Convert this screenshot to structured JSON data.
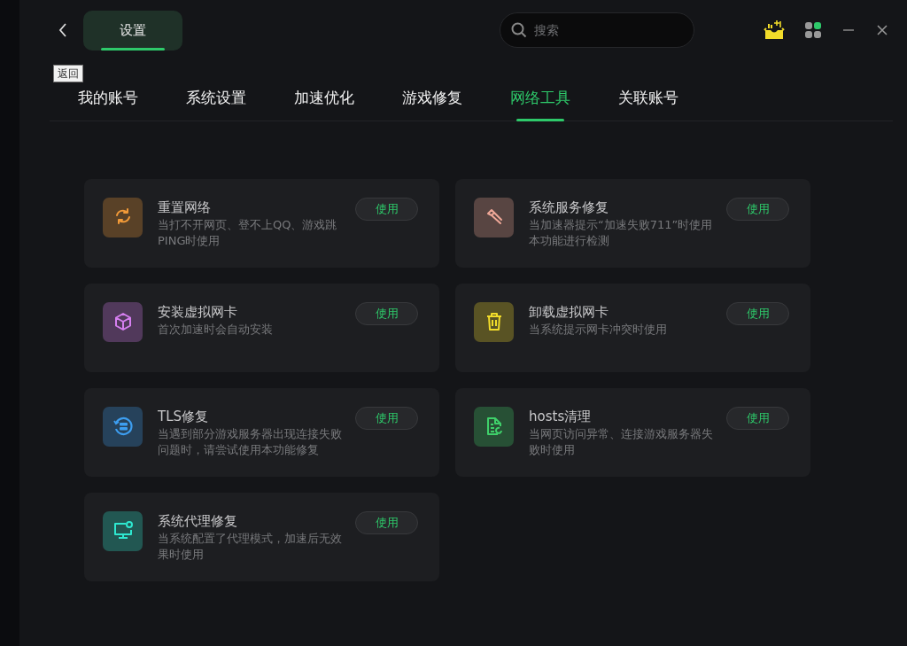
{
  "header": {
    "title_tab": "设置",
    "back_tooltip": "返回",
    "search": {
      "placeholder": "搜索"
    }
  },
  "tabs": [
    {
      "label": "我的账号",
      "selected": false
    },
    {
      "label": "系统设置",
      "selected": false
    },
    {
      "label": "加速优化",
      "selected": false
    },
    {
      "label": "游戏修复",
      "selected": false
    },
    {
      "label": "网络工具",
      "selected": true
    },
    {
      "label": "关联账号",
      "selected": false
    }
  ],
  "tools": [
    {
      "kind": "refresh",
      "color": "#f29a38",
      "title": "重置网络",
      "description": "当打不开网页、登不上QQ、游戏跳PING时使用",
      "button": "使用"
    },
    {
      "kind": "wrench",
      "color": "#f0a898",
      "title": "系统服务修复",
      "description": "当加速器提示“加速失败711”时使用本功能进行检测",
      "button": "使用"
    },
    {
      "kind": "cube",
      "color": "#d67ff0",
      "title": "安装虚拟网卡",
      "description": "首次加速时会自动安装",
      "button": "使用"
    },
    {
      "kind": "trash",
      "color": "#f2dc2a",
      "title": "卸载虚拟网卡",
      "description": "当系统提示网卡冲突时使用",
      "button": "使用"
    },
    {
      "kind": "server",
      "color": "#3d9ef0",
      "title": "TLS修复",
      "description": "当遇到部分游戏服务器出现连接失败问题时，请尝试使用本功能修复",
      "button": "使用"
    },
    {
      "kind": "file",
      "color": "#3fd06a",
      "title": "hosts清理",
      "description": "当网页访问异常、连接游戏服务器失败时使用",
      "button": "使用"
    },
    {
      "kind": "monitor",
      "color": "#2ee8d0",
      "title": "系统代理修复",
      "description": "当系统配置了代理模式，加速后无效果时使用",
      "button": "使用"
    }
  ]
}
